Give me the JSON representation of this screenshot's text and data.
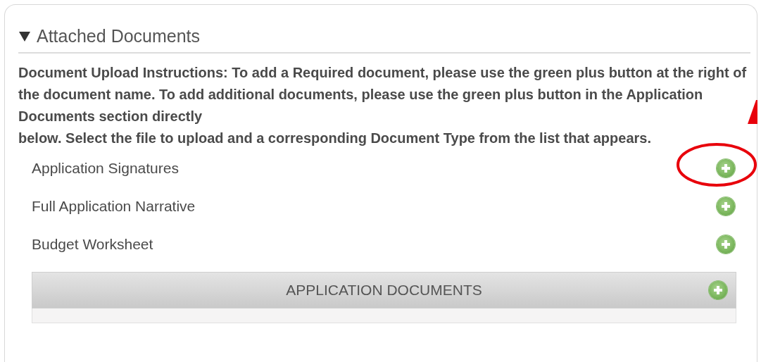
{
  "section": {
    "title": "Attached Documents",
    "expanded": true
  },
  "instructions": "Document Upload Instructions: To add a Required document, please use the green plus button at the right of the document name. To add additional documents, please use the green plus button in the Application Documents section directly\nbelow. Select the file to upload and a corresponding Document Type from the list that appears.",
  "required_documents": [
    {
      "name": "Application Signatures",
      "highlighted": true
    },
    {
      "name": "Full Application Narrative",
      "highlighted": false
    },
    {
      "name": "Budget Worksheet",
      "highlighted": false
    }
  ],
  "application_documents": {
    "title": "APPLICATION DOCUMENTS"
  }
}
